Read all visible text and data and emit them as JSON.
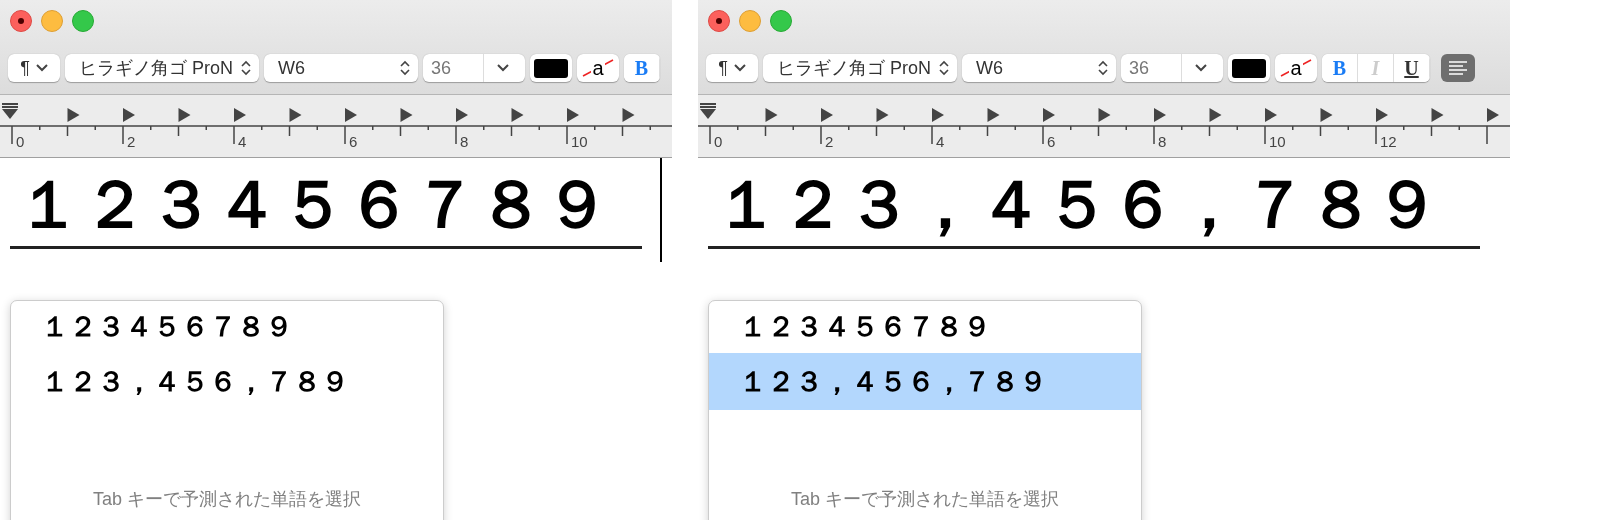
{
  "windows": [
    {
      "toolbar": {
        "paragraph": "¶",
        "font_family": "ヒラギノ角ゴ ProN",
        "font_weight": "W6",
        "font_size": "36",
        "bg_color_glyph": "a",
        "style_buttons": [
          {
            "label": "B",
            "kind": "bold",
            "disabled": false
          }
        ],
        "align_button": false
      },
      "ruler": {
        "labels": [
          "0",
          "2",
          "4",
          "6",
          "8",
          "10"
        ]
      },
      "text": "１２３４５６７８９",
      "caret": true,
      "candidates": {
        "items": [
          {
            "label": "１２３４５６７８９",
            "selected": false
          },
          {
            "label": "１２３，４５６，７８９",
            "selected": false
          }
        ],
        "hint": "Tab キーで予測された単語を選択"
      }
    },
    {
      "toolbar": {
        "paragraph": "¶",
        "font_family": "ヒラギノ角ゴ ProN",
        "font_weight": "W6",
        "font_size": "36",
        "bg_color_glyph": "a",
        "style_buttons": [
          {
            "label": "B",
            "kind": "bold",
            "disabled": false
          },
          {
            "label": "I",
            "kind": "italic",
            "disabled": true
          },
          {
            "label": "U",
            "kind": "underline",
            "disabled": false
          }
        ],
        "align_button": true
      },
      "ruler": {
        "labels": [
          "0",
          "2",
          "4",
          "6",
          "8",
          "10",
          "12"
        ]
      },
      "text": "１２３，４５６，７８９",
      "caret": false,
      "candidates": {
        "items": [
          {
            "label": "１２３４５６７８９",
            "selected": false
          },
          {
            "label": "１２３，４５６，７８９",
            "selected": true
          }
        ],
        "hint": "Tab キーで予測された単語を選択"
      }
    }
  ]
}
